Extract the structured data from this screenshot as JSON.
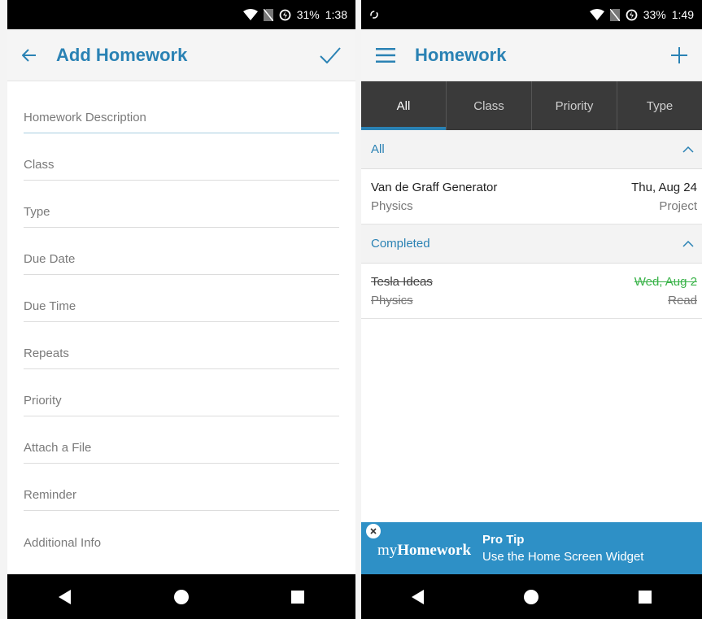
{
  "left": {
    "status": {
      "battery": "31%",
      "time": "1:38"
    },
    "app_bar": {
      "title": "Add Homework"
    },
    "fields": [
      {
        "placeholder": "Homework Description"
      },
      {
        "placeholder": "Class"
      },
      {
        "placeholder": "Type"
      },
      {
        "placeholder": "Due Date"
      },
      {
        "placeholder": "Due Time"
      },
      {
        "placeholder": "Repeats"
      },
      {
        "placeholder": "Priority"
      },
      {
        "placeholder": "Attach a File"
      },
      {
        "placeholder": "Reminder"
      },
      {
        "placeholder": "Additional Info"
      }
    ]
  },
  "right": {
    "status": {
      "battery": "33%",
      "time": "1:49"
    },
    "app_bar": {
      "title": "Homework"
    },
    "tabs": [
      {
        "label": "All",
        "active": true
      },
      {
        "label": "Class"
      },
      {
        "label": "Priority"
      },
      {
        "label": "Type"
      }
    ],
    "sections": [
      {
        "title": "All",
        "items": [
          {
            "title": "Van de Graff Generator",
            "class": "Physics",
            "date": "Thu, Aug 24",
            "type": "Project"
          }
        ]
      },
      {
        "title": "Completed",
        "items": [
          {
            "title": "Tesla Ideas",
            "class": "Physics",
            "date": "Wed, Aug 2",
            "type": "Read"
          }
        ]
      }
    ],
    "ad": {
      "logo_prefix": "my",
      "logo_bold": "Homework",
      "title": "Pro Tip",
      "text": "Use the Home Screen Widget"
    }
  },
  "colors": {
    "accent": "#2a82b4",
    "banner": "#2e90c6",
    "completed_date": "#3bb34a",
    "tab_bar": "#3a3a3a"
  },
  "icons": [
    "back-arrow-icon",
    "check-icon",
    "menu-icon",
    "plus-icon",
    "chevron-up-icon",
    "wifi-icon",
    "no-sim-icon",
    "battery-saver-icon",
    "sync-icon",
    "back-nav-icon",
    "home-nav-icon",
    "recents-nav-icon",
    "close-icon"
  ]
}
